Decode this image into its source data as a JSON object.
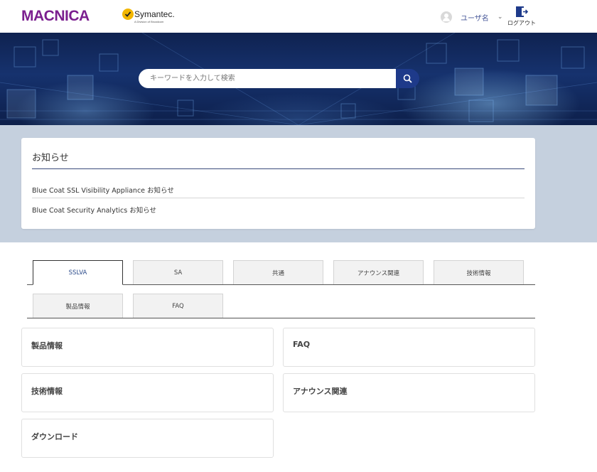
{
  "header": {
    "brand_logo": "MACNICA",
    "partner_logo_name": "Symantec.",
    "partner_logo_sub": "A Division of Broadcom",
    "user_name": "ユーザ名",
    "logout_label": "ログアウト"
  },
  "search": {
    "placeholder": "キーワードを入力して検索",
    "icon": "search-icon"
  },
  "notices": {
    "title": "お知らせ",
    "items": [
      "Blue Coat SSL Visibility Appliance お知らせ",
      "Blue Coat Security Analytics お知らせ"
    ]
  },
  "tabs": [
    {
      "label": "SSLVA",
      "active": true
    },
    {
      "label": "SA",
      "active": false
    },
    {
      "label": "共通",
      "active": false
    },
    {
      "label": "アナウンス関連",
      "active": false
    },
    {
      "label": "技術情報",
      "active": false
    },
    {
      "label": "製品情報",
      "active": false
    },
    {
      "label": "FAQ",
      "active": false
    }
  ],
  "categories": [
    "製品情報",
    "FAQ",
    "技術情報",
    "アナウンス関連",
    "ダウンロード"
  ],
  "colors": {
    "brand": "#7b1f8f",
    "accent": "#1e3a8a",
    "band": "#c5d0de"
  }
}
